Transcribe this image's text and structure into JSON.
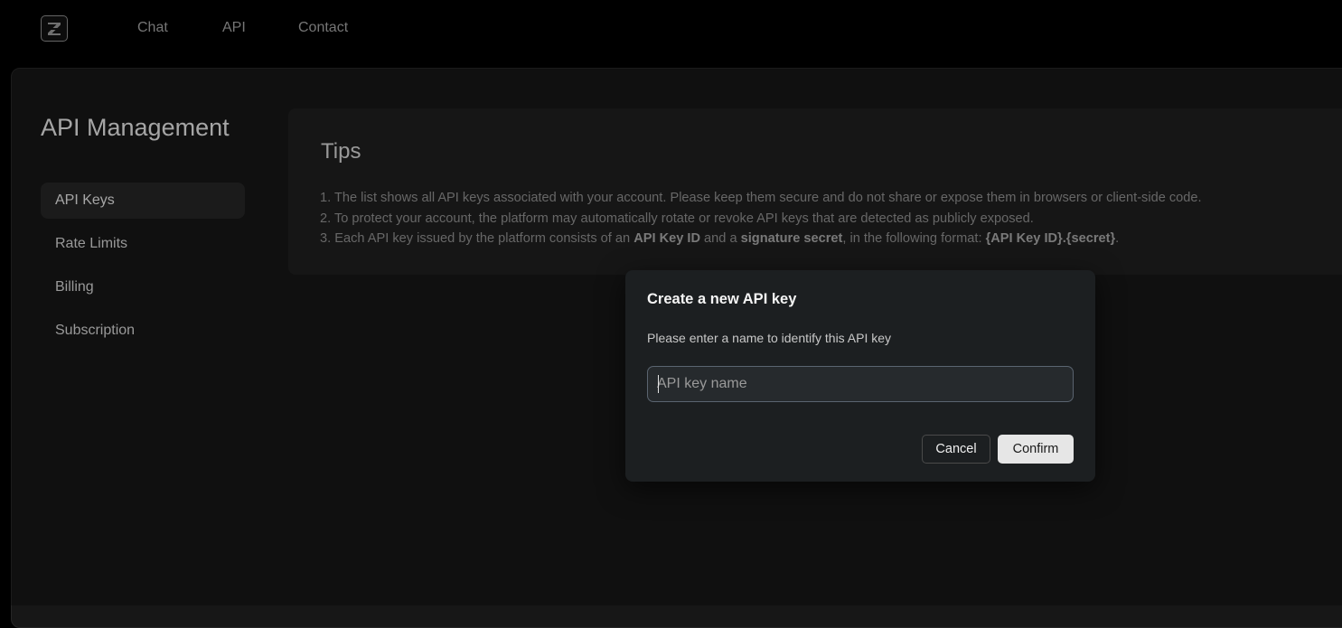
{
  "brand": {
    "logo_icon": "z-logo-icon"
  },
  "nav": {
    "chat": "Chat",
    "api": "API",
    "contact": "Contact"
  },
  "page": {
    "title": "API Management"
  },
  "sidebar": {
    "items": [
      {
        "label": "API Keys",
        "active": true
      },
      {
        "label": "Rate Limits",
        "active": false
      },
      {
        "label": "Billing",
        "active": false
      },
      {
        "label": "Subscription",
        "active": false
      }
    ]
  },
  "tips": {
    "title": "Tips",
    "line1": "1. The list shows all API keys associated with your account. Please keep them secure and do not share or expose them in browsers or client-side code.",
    "line2": "2. To protect your account, the platform may automatically rotate or revoke API keys that are detected as publicly exposed.",
    "line3_prefix": "3. Each API key issued by the platform consists of an ",
    "line3_bold1": "API Key ID",
    "line3_mid": " and a ",
    "line3_bold2": "signature secret",
    "line3_mid2": ", in the following format: ",
    "line3_bold3": "{API Key ID}.{secret}",
    "line3_suffix": "."
  },
  "modal": {
    "title": "Create a new API key",
    "description": "Please enter a name to identify this API key",
    "input_placeholder": "API key name",
    "input_value": "",
    "cancel_label": "Cancel",
    "confirm_label": "Confirm"
  }
}
